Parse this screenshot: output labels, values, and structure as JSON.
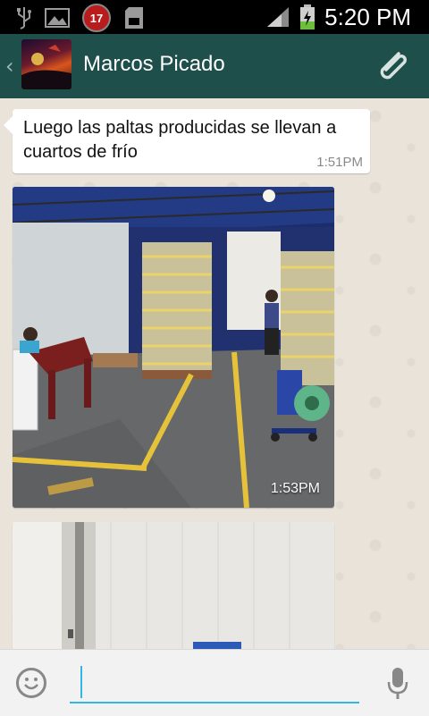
{
  "status_bar": {
    "time": "5:20 PM",
    "notification_count": "17",
    "icons": [
      "usb-icon",
      "image-icon",
      "notification-badge",
      "sd-card-icon",
      "signal-icon",
      "battery-charging-icon"
    ]
  },
  "header": {
    "contact_name": "Marcos Picado",
    "icons": [
      "back-chevron-icon",
      "avatar",
      "attach-icon"
    ],
    "colors": {
      "bar": "#1f4f4a"
    }
  },
  "messages": [
    {
      "type": "text",
      "text": "Luego las paltas producidas se llevan a cuartos de frío",
      "time": "1:51PM"
    },
    {
      "type": "image",
      "time": "1:53PM"
    },
    {
      "type": "image",
      "time": ""
    }
  ],
  "input": {
    "placeholder": "",
    "value": ""
  },
  "colors": {
    "accent": "#33b5e5",
    "chat_bg": "#e9e3da",
    "bubble": "#ffffff"
  }
}
